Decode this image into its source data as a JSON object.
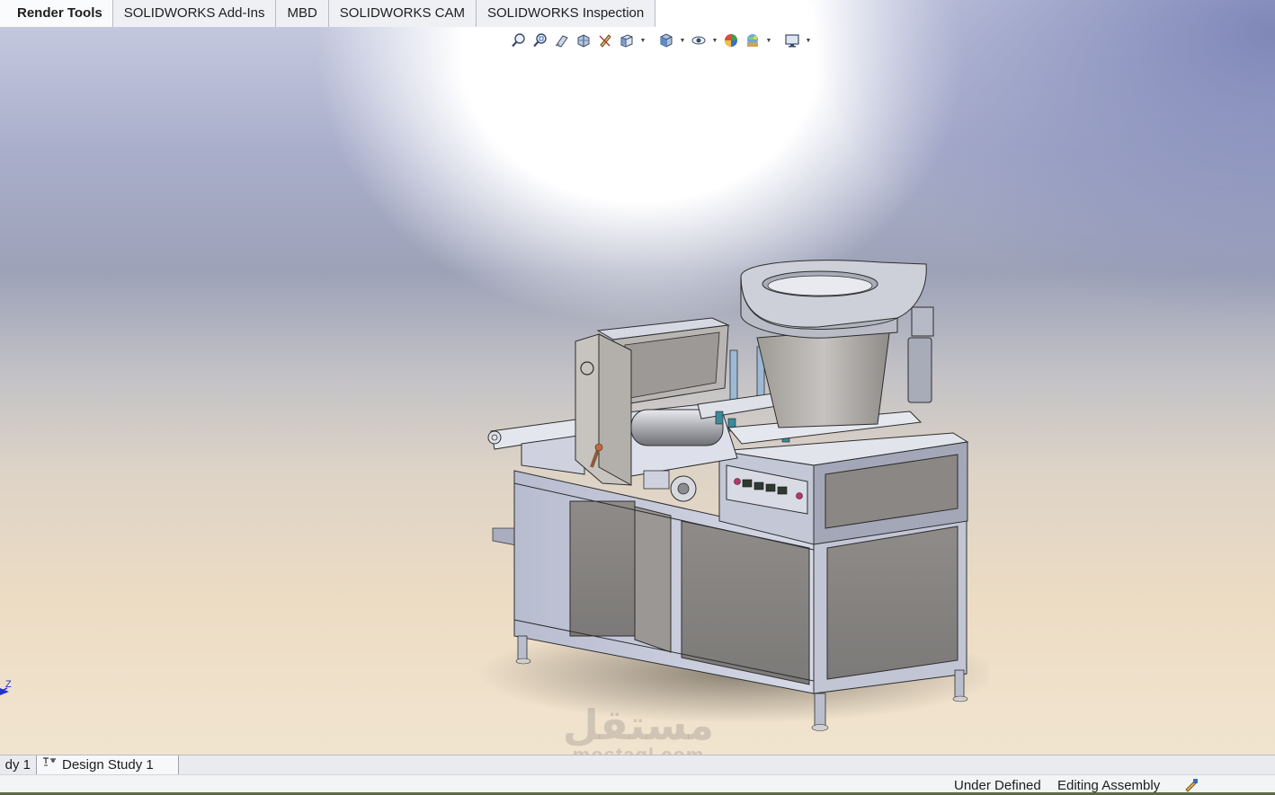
{
  "command_tabs": [
    {
      "label": "Render Tools",
      "active": true
    },
    {
      "label": "SOLIDWORKS Add-Ins",
      "active": false
    },
    {
      "label": "MBD",
      "active": false
    },
    {
      "label": "SOLIDWORKS CAM",
      "active": false
    },
    {
      "label": "SOLIDWORKS Inspection",
      "active": false
    }
  ],
  "heads_up_toolbar": [
    "zoom-to-fit-icon",
    "zoom-to-area-icon",
    "previous-view-icon",
    "section-view-icon",
    "dynamic-annotation-icon",
    "view-orientation-icon",
    "display-style-icon",
    "hide-show-items-icon",
    "edit-appearance-icon",
    "apply-scene-icon",
    "view-settings-icon"
  ],
  "triad": {
    "axis_label": "Z"
  },
  "watermark": {
    "arabic": "مستقل",
    "latin": "mostaql.com"
  },
  "study_tabs": [
    {
      "label": "dy 1"
    },
    {
      "label": "Design Study 1"
    }
  ],
  "status": {
    "definition": "Under Defined",
    "mode": "Editing Assembly"
  },
  "colors": {
    "viewport_top": "#c9cde2",
    "viewport_bottom": "#f1e4cf",
    "metal": "#c8ccdc",
    "panel": "#8e8a86"
  }
}
